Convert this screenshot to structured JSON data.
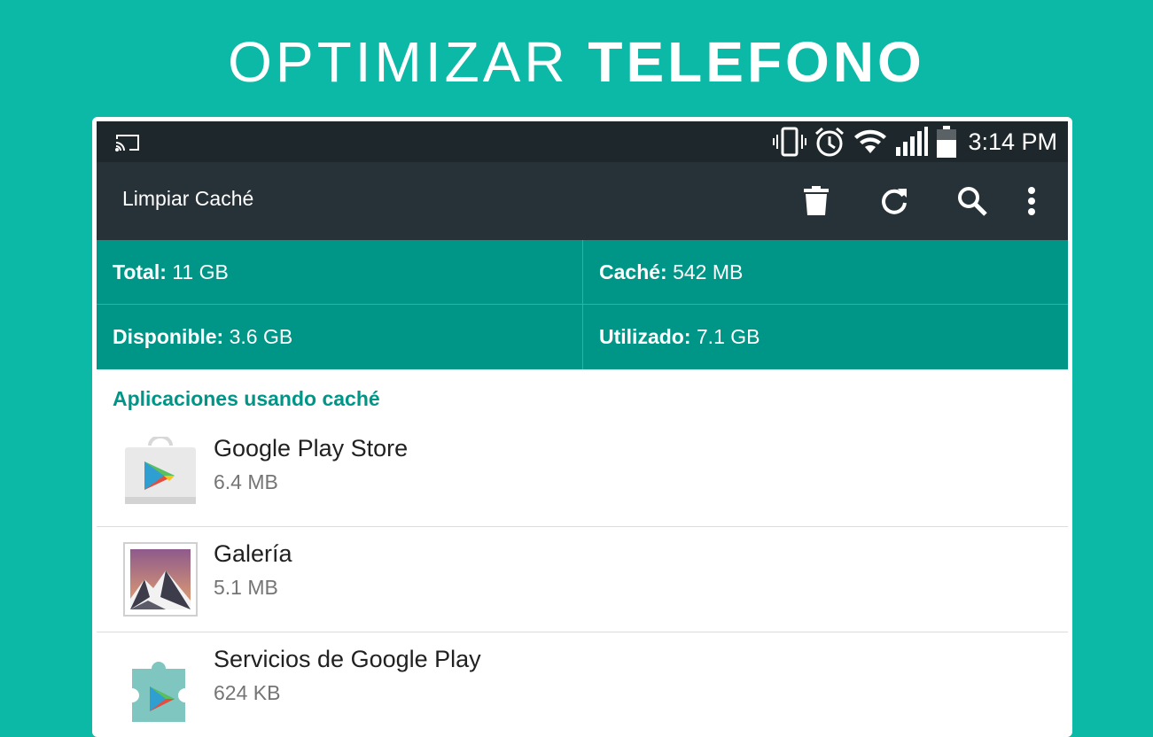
{
  "promo": {
    "title_light": "OPTIMIZAR",
    "title_bold": "TELEFONO"
  },
  "status_bar": {
    "time": "3:14 PM",
    "icons": [
      "cast-icon",
      "vibrate-icon",
      "alarm-icon",
      "wifi-icon",
      "signal-icon",
      "battery-icon"
    ]
  },
  "toolbar": {
    "title": "Limpiar Caché",
    "actions": [
      "delete-icon",
      "refresh-icon",
      "search-icon",
      "more-vert-icon"
    ]
  },
  "stats": {
    "total_label": "Total:",
    "total_value": "11 GB",
    "cache_label": "Caché:",
    "cache_value": "542 MB",
    "available_label": "Disponible:",
    "available_value": "3.6 GB",
    "used_label": "Utilizado:",
    "used_value": "7.1 GB"
  },
  "section": {
    "title": "Aplicaciones usando caché"
  },
  "apps": [
    {
      "name": "Google Play Store",
      "size": "6.4 MB",
      "icon": "play-store-icon"
    },
    {
      "name": "Galería",
      "size": "5.1 MB",
      "icon": "gallery-icon"
    },
    {
      "name": "Servicios de Google Play",
      "size": "624 KB",
      "icon": "play-services-icon"
    }
  ],
  "colors": {
    "background": "#0cb8a6",
    "status_bar": "#1e272b",
    "toolbar": "#263238",
    "stats_panel": "#009687",
    "accent": "#009687"
  }
}
